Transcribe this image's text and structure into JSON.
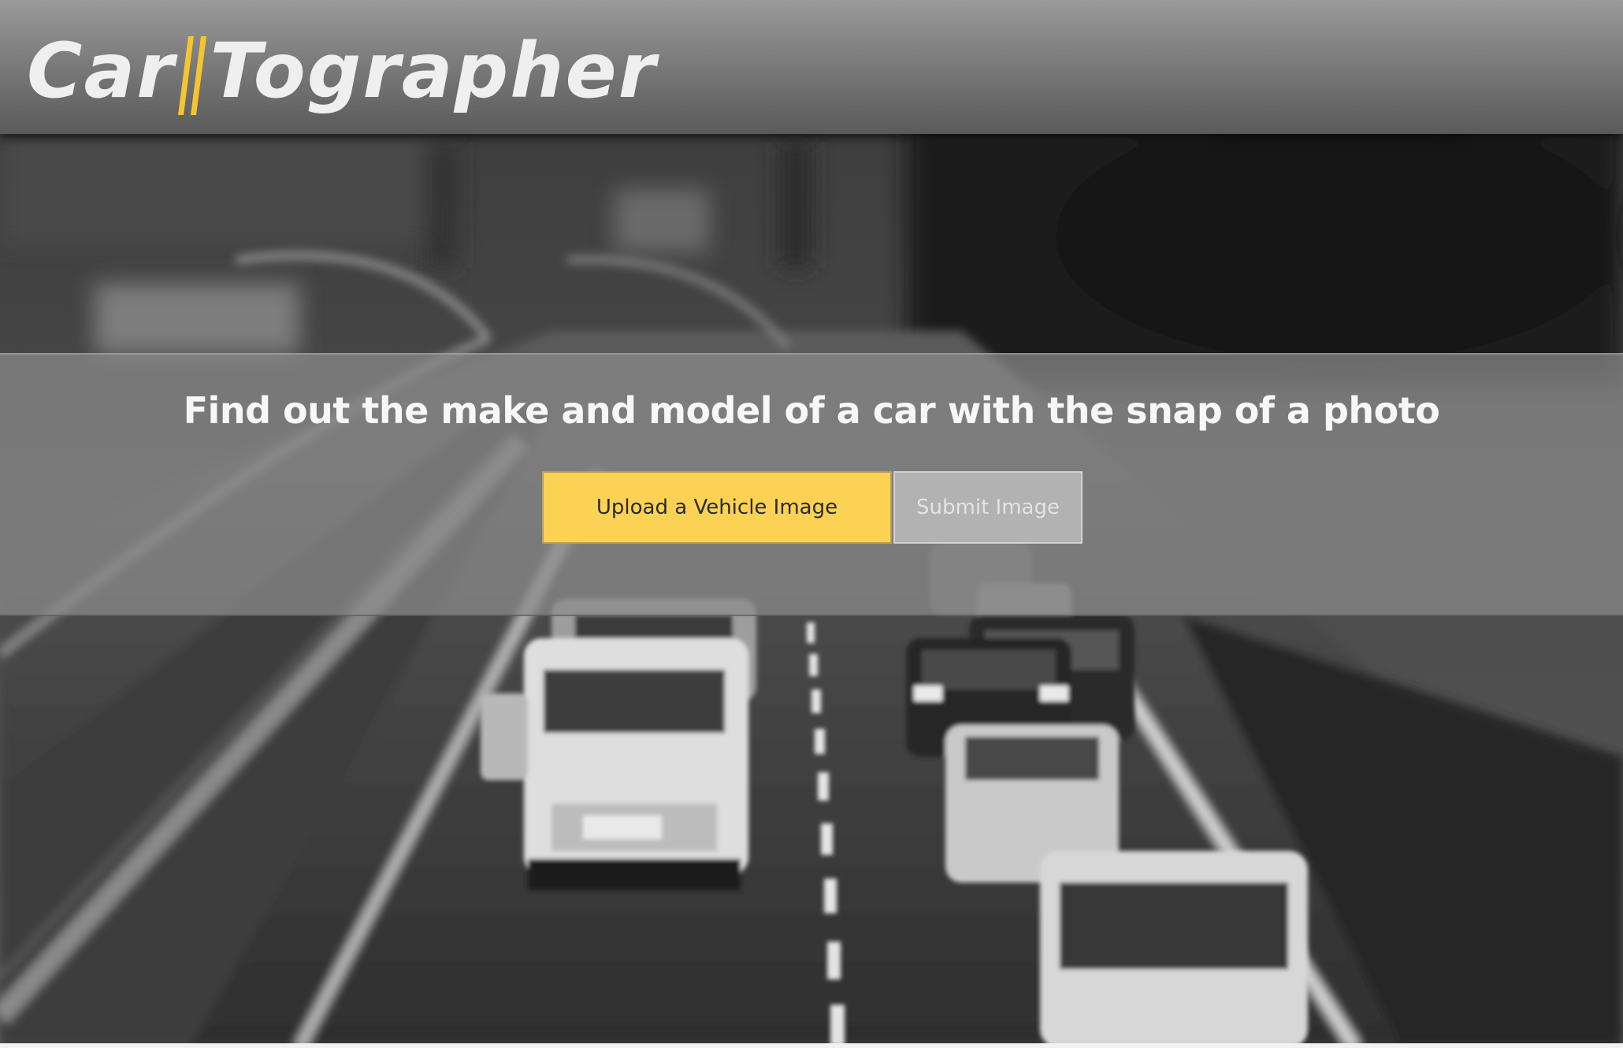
{
  "brand": {
    "name_part1": "Car",
    "name_part2": "Tographer",
    "slash_color": "#f4c531"
  },
  "hero": {
    "tagline": "Find out the make and model of a car with the snap of a photo",
    "upload_label": "Upload a Vehicle Image",
    "submit_label": "Submit Image"
  },
  "colors": {
    "accent": "#fcd254",
    "header": "#7c7c7c",
    "disabled_button": "#b2b2b2"
  },
  "icons": {
    "logo_divider": "double-slash-icon"
  }
}
